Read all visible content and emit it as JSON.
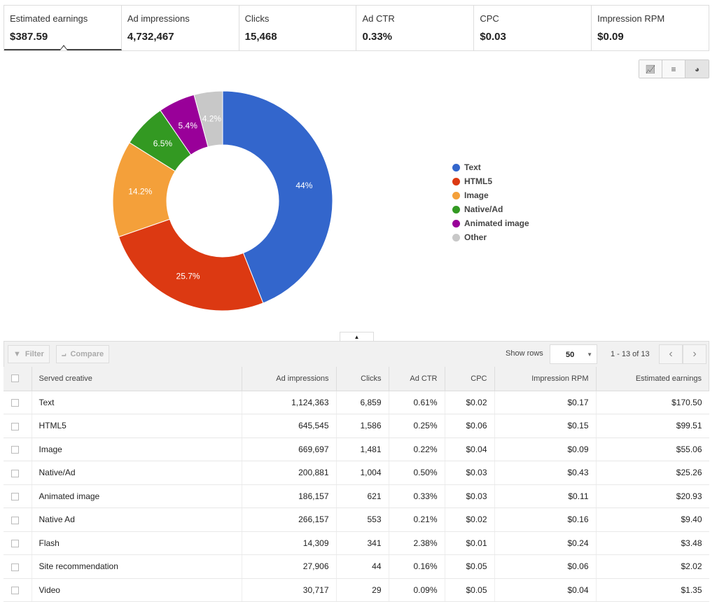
{
  "summary": [
    {
      "label": "Estimated earnings",
      "value": "$387.59",
      "selected": true
    },
    {
      "label": "Ad impressions",
      "value": "4,732,467"
    },
    {
      "label": "Clicks",
      "value": "15,468"
    },
    {
      "label": "Ad CTR",
      "value": "0.33%"
    },
    {
      "label": "CPC",
      "value": "$0.03"
    },
    {
      "label": "Impression RPM",
      "value": "$0.09"
    }
  ],
  "chart_toggles": [
    "line-chart-icon",
    "bar-chart-icon",
    "pie-chart-icon"
  ],
  "chart_data": {
    "type": "pie",
    "donut": true,
    "categories": [
      "Text",
      "HTML5",
      "Image",
      "Native/Ad",
      "Animated image",
      "Other"
    ],
    "values": [
      44,
      25.7,
      14.2,
      6.5,
      5.4,
      4.2
    ],
    "labels": [
      "44%",
      "25.7%",
      "14.2%",
      "6.5%",
      "5.4%",
      "4.2%"
    ],
    "colors": [
      "#3366cc",
      "#dc3912",
      "#f4a03a",
      "#339922",
      "#990099",
      "#c8c8c8"
    ],
    "legend": "right"
  },
  "toolbar": {
    "filter": "Filter",
    "compare": "Compare",
    "show_rows": "Show rows",
    "rows_value": "50",
    "range": "1 - 13 of 13"
  },
  "table": {
    "headers": [
      "Served creative",
      "Ad impressions",
      "Clicks",
      "Ad CTR",
      "CPC",
      "Impression RPM",
      "Estimated earnings"
    ],
    "rows": [
      [
        "Text",
        "1,124,363",
        "6,859",
        "0.61%",
        "$0.02",
        "$0.17",
        "$170.50"
      ],
      [
        "HTML5",
        "645,545",
        "1,586",
        "0.25%",
        "$0.06",
        "$0.15",
        "$99.51"
      ],
      [
        "Image",
        "669,697",
        "1,481",
        "0.22%",
        "$0.04",
        "$0.09",
        "$55.06"
      ],
      [
        "Native/Ad",
        "200,881",
        "1,004",
        "0.50%",
        "$0.03",
        "$0.43",
        "$25.26"
      ],
      [
        "Animated image",
        "186,157",
        "621",
        "0.33%",
        "$0.03",
        "$0.11",
        "$20.93"
      ],
      [
        "Native Ad",
        "266,157",
        "553",
        "0.21%",
        "$0.02",
        "$0.16",
        "$9.40"
      ],
      [
        "Flash",
        "14,309",
        "341",
        "2.38%",
        "$0.01",
        "$0.24",
        "$3.48"
      ],
      [
        "Site recommendation",
        "27,906",
        "44",
        "0.16%",
        "$0.05",
        "$0.06",
        "$2.02"
      ],
      [
        "Video",
        "30,717",
        "29",
        "0.09%",
        "$0.05",
        "$0.04",
        "$1.35"
      ]
    ]
  }
}
